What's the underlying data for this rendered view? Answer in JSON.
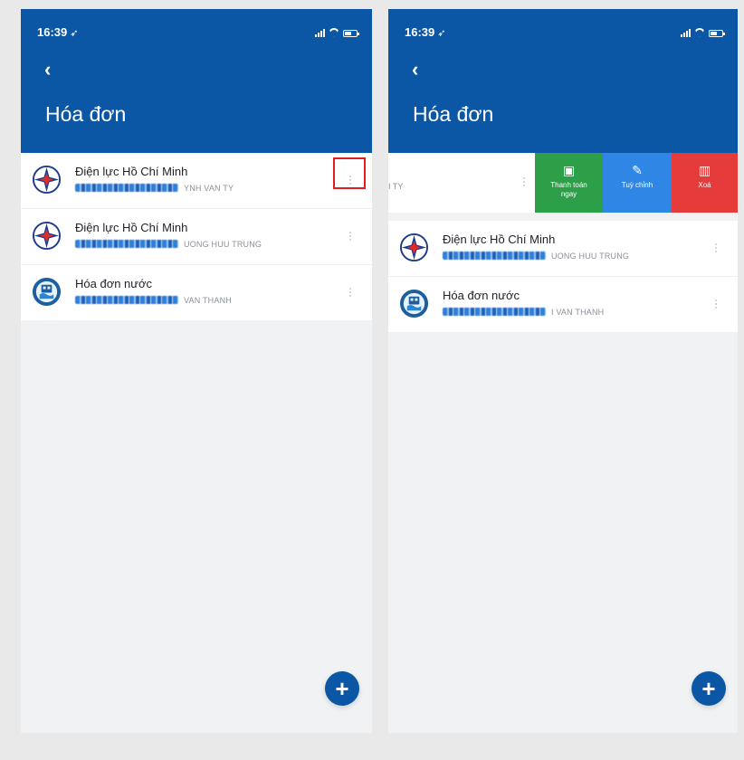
{
  "colors": {
    "header": "#0b56a5",
    "pay_action": "#2e9f49",
    "customize_action": "#2f86e5",
    "delete_action": "#e63b3b",
    "highlight_box": "#e01e22"
  },
  "left_screen": {
    "status_time": "16:39",
    "page_title": "Hóa đơn",
    "bills": [
      {
        "name": "Điện lực Hồ Chí Minh",
        "owner": "YNH VAN TY",
        "icon": "electricity-logo"
      },
      {
        "name": "Điện lực Hồ Chí Minh",
        "owner": "UONG HUU TRUNG",
        "icon": "electricity-logo"
      },
      {
        "name": "Hóa đơn nước",
        "owner": "VAN THANH",
        "icon": "water-logo"
      }
    ]
  },
  "right_screen": {
    "status_time": "16:39",
    "page_title": "Hóa đơn",
    "swiped_remnant": "I TY",
    "actions": {
      "pay": "Thanh toán ngay",
      "customize": "Tuỳ chỉnh",
      "delete": "Xoá"
    },
    "bills": [
      {
        "name": "Điện lực Hồ Chí Minh",
        "owner": "UONG HUU TRUNG",
        "icon": "electricity-logo"
      },
      {
        "name": "Hóa đơn nước",
        "owner": "I VAN THANH",
        "icon": "water-logo"
      }
    ]
  },
  "icons": {
    "back": "chevron-left-icon",
    "more": "kebab-menu-icon",
    "add": "plus-icon",
    "pay": "wallet-icon",
    "customize": "pencil-icon",
    "delete": "trash-icon"
  }
}
